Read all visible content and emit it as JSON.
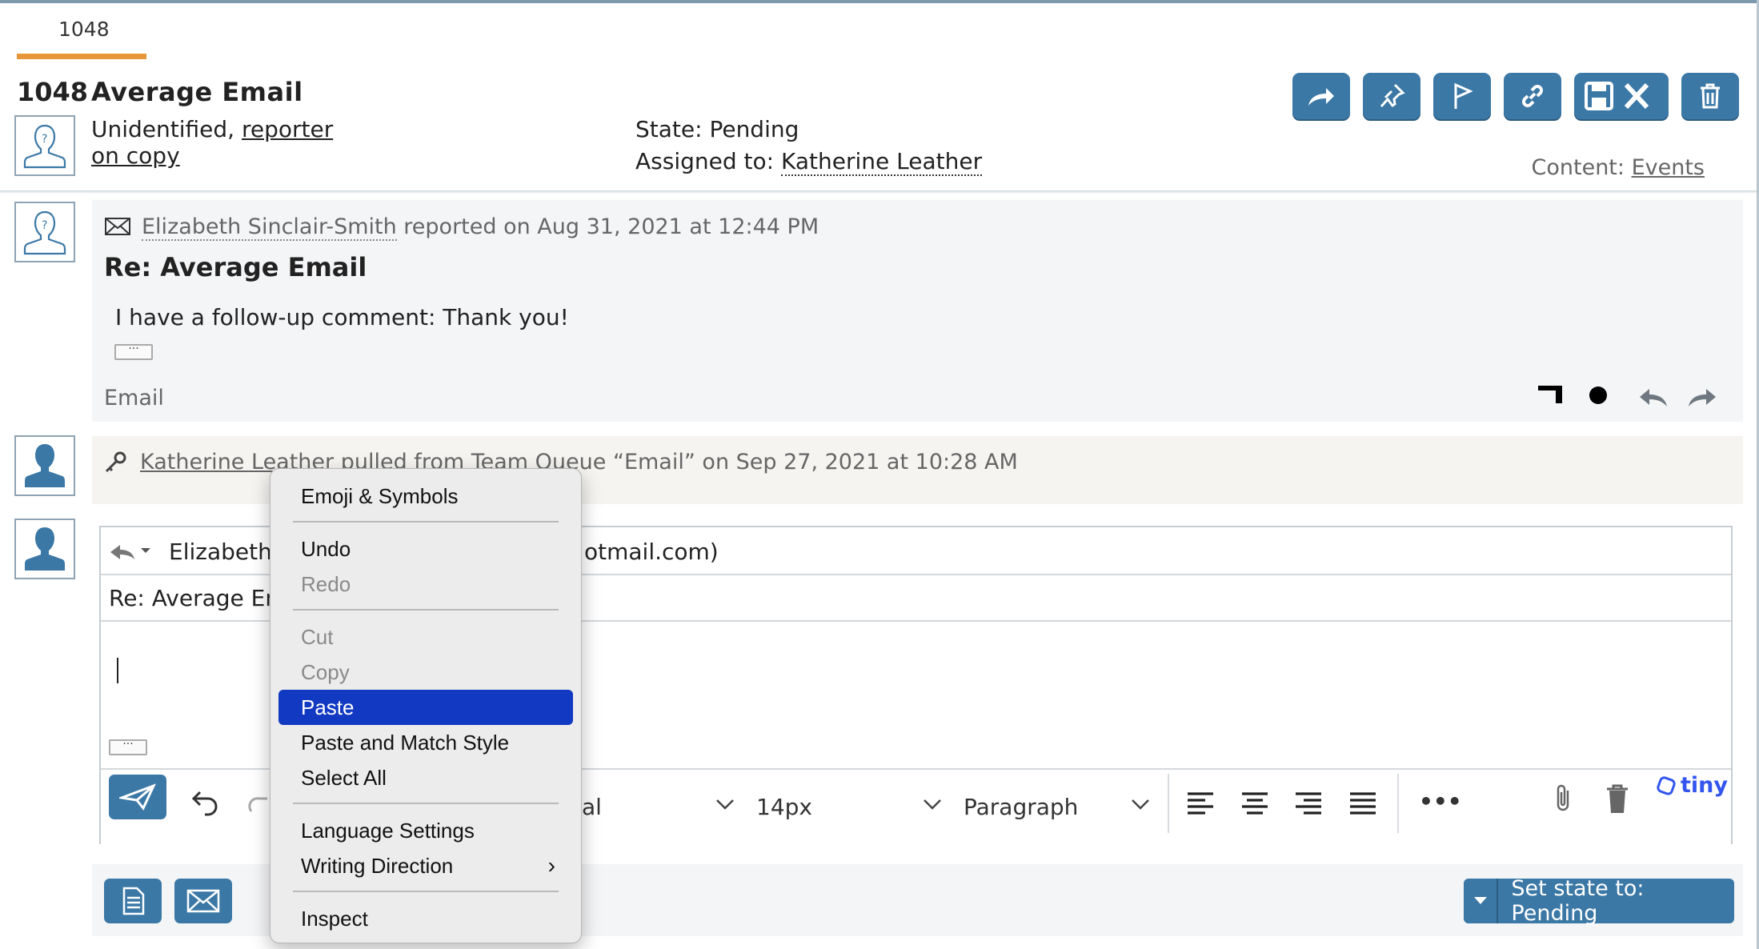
{
  "header": {
    "tab_label": "1048",
    "ticket_id": "1048",
    "ticket_title": "Average Email",
    "requester_prefix": "Unidentified, ",
    "requester_link": "reporter",
    "requester_link2": "on copy",
    "state_label": "State: Pending",
    "assigned_prefix": "Assigned to: ",
    "assigned_name": "Katherine Leather",
    "content_prefix": "Content: ",
    "content_link": "Events",
    "toolbar_icons": [
      "forward-icon",
      "pin-icon",
      "flag-icon",
      "link-icon",
      "save-close-icon",
      "trash-icon"
    ]
  },
  "event1": {
    "author": "Elizabeth Sinclair-Smith",
    "meta_rest": " reported on Aug 31, 2021 at 12:44 PM",
    "subject": "Re: Average Email",
    "body": "I have a follow-up comment: Thank you!",
    "ellipsis": "···",
    "type": "Email"
  },
  "event2": {
    "text_name": "Katherine Leather",
    "text_rest": " pulled from Team Queue “Email” on Sep 27, 2021 at 10:28 AM"
  },
  "compose": {
    "to_visible": "Elizabeth",
    "to_tail": "otmail.com)",
    "subject_visible": "Re: Average Em",
    "ellipsis": "···",
    "font_family_tail": "al",
    "font_size": "14px",
    "block_format": "Paragraph",
    "more": "•••",
    "brand": "tiny"
  },
  "bottom": {
    "set_state_label": "Set state to: Pending"
  },
  "context_menu": {
    "items": [
      {
        "label": "Emoji & Symbols",
        "enabled": true
      },
      {
        "label": "Undo",
        "enabled": true
      },
      {
        "label": "Redo",
        "enabled": false
      },
      {
        "label": "Cut",
        "enabled": false
      },
      {
        "label": "Copy",
        "enabled": false
      },
      {
        "label": "Paste",
        "enabled": true,
        "highlighted": true
      },
      {
        "label": "Paste and Match Style",
        "enabled": true
      },
      {
        "label": "Select All",
        "enabled": true
      },
      {
        "label": "Language Settings",
        "enabled": true
      },
      {
        "label": "Writing Direction",
        "enabled": true,
        "submenu": true
      },
      {
        "label": "Inspect",
        "enabled": true
      }
    ]
  },
  "colors": {
    "accent": "#3b78a6",
    "tab_underline": "#e8963a",
    "menu_highlight": "#1239c2"
  }
}
